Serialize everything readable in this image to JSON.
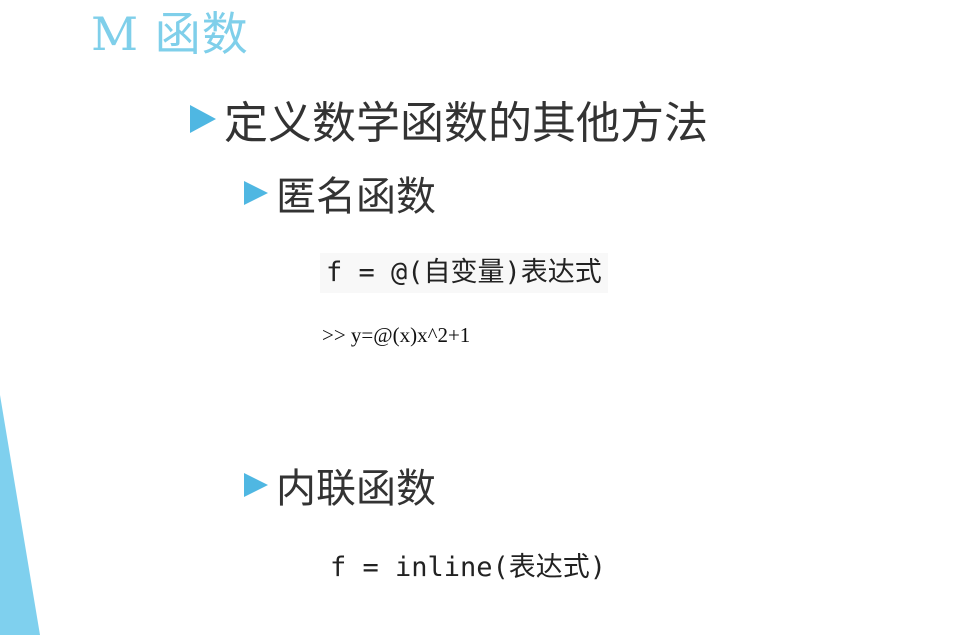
{
  "slide": {
    "title": "M 函数",
    "bullets": {
      "main": "定义数学函数的其他方法",
      "anonymous": "匿名函数",
      "inline": "内联函数"
    },
    "code": {
      "anonymous_syntax": "f = @(自变量)表达式",
      "anonymous_example": ">> y=@(x)x^2+1",
      "inline_syntax": "f = inline(表达式)"
    }
  },
  "colors": {
    "title": "#7fcfea",
    "bullet_marker": "#4fb7e2",
    "decor_strip": "#7fd0ee"
  }
}
